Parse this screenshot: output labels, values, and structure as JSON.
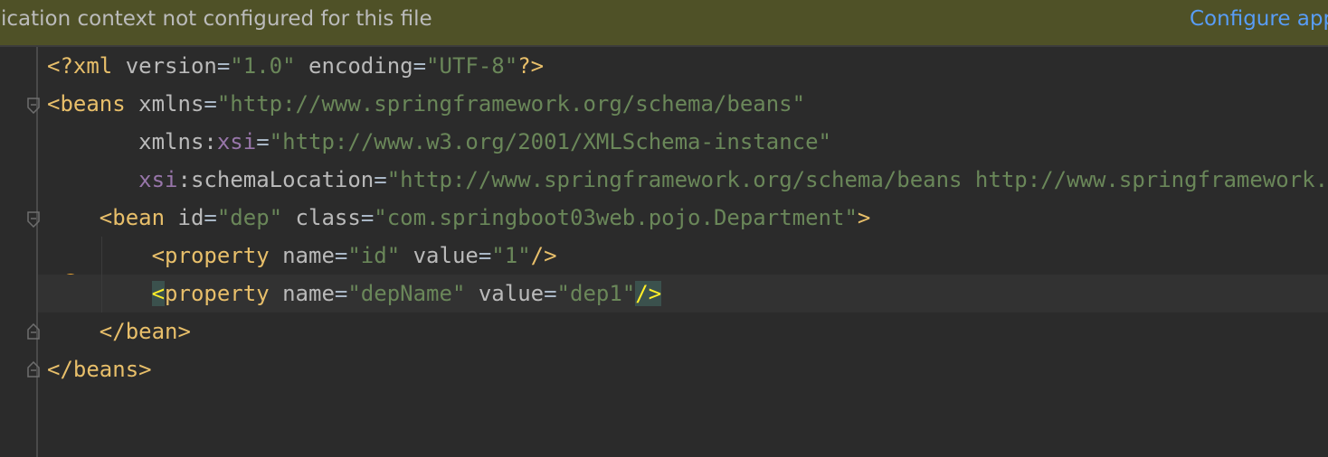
{
  "banner": {
    "message": "plication context not configured for this file",
    "action": "Configure app"
  },
  "colors": {
    "banner_bg": "#4f5127",
    "editor_bg": "#2b2b2b",
    "tag": "#e8bf6a",
    "attribute": "#bababa",
    "namespace": "#9876aa",
    "value": "#6a8759",
    "link": "#589df6",
    "brace_highlight": "#ffef28"
  },
  "code": {
    "l1": {
      "decl_open": "<?xml",
      "a1": " version",
      "eq1": "=",
      "v1": "\"1.0\"",
      "a2": " encoding",
      "eq2": "=",
      "v2": "\"UTF-8\"",
      "decl_close": "?>"
    },
    "l2": {
      "open": "<beans",
      "a1": " xmlns",
      "eq": "=",
      "v1": "\"http://www.springframework.org/schema/beans\""
    },
    "l3": {
      "indent": "       ",
      "a1": "xmlns:",
      "ns": "xsi",
      "eq": "=",
      "v1": "\"http://www.w3.org/2001/XMLSchema-instance\""
    },
    "l4": {
      "indent": "       ",
      "ns": "xsi",
      "a1": ":schemaLocation",
      "eq": "=",
      "v1": "\"http://www.springframework.org/schema/beans http://www.springframework.org/schema/beans/spring-beans.xsd\""
    },
    "l5": {
      "indent": "    ",
      "open": "<bean",
      "a1": " id",
      "eq1": "=",
      "v1": "\"dep\"",
      "a2": " class",
      "eq2": "=",
      "v2": "\"com.springboot03web.pojo.Department\"",
      "close": ">"
    },
    "l6": {
      "indent": "        ",
      "open": "<property",
      "a1": " name",
      "eq1": "=",
      "v1": "\"id\"",
      "a2": " value",
      "eq2": "=",
      "v2": "\"1\"",
      "close": "/>"
    },
    "l7": {
      "indent": "        ",
      "lt": "<",
      "name": "property",
      "a1": " name",
      "eq1": "=",
      "v1": "\"depName\"",
      "a2": " value",
      "eq2": "=",
      "v2": "\"dep1\"",
      "close": "/>"
    },
    "l8": {
      "indent": "    ",
      "close": "</bean>"
    },
    "l9": {
      "close": "</beans>"
    }
  },
  "gutter": {
    "intention_icon": "lightbulb-icon",
    "fold_icons": "fold-marker-icon"
  }
}
